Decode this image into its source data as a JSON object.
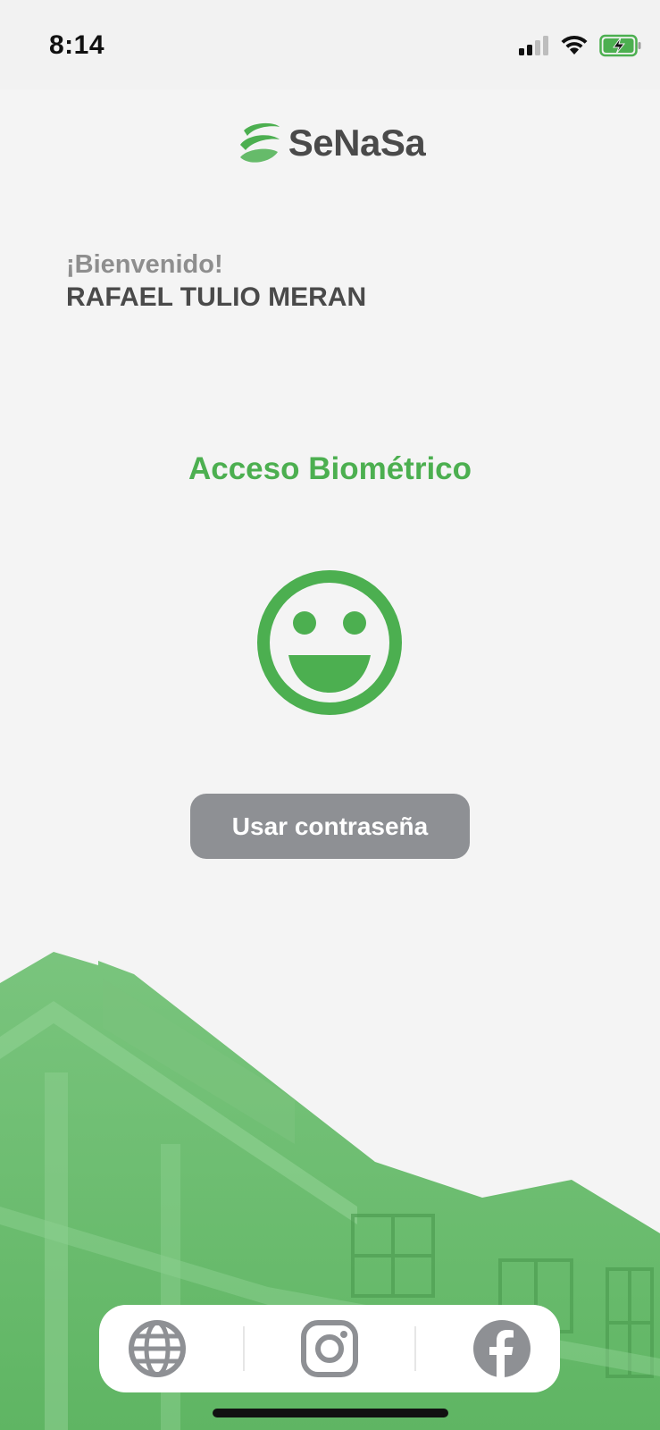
{
  "status_bar": {
    "time": "8:14",
    "icons": [
      "cellular-signal-icon",
      "wifi-icon",
      "battery-charging-icon"
    ]
  },
  "header": {
    "logo_text": "SeNaSa",
    "logo_icon": "senasa-logo-icon"
  },
  "welcome": {
    "greeting": "¡Bienvenido!",
    "user_name": "RAFAEL TULIO MERAN"
  },
  "biometric": {
    "title": "Acceso Biométrico",
    "icon": "face-id-smile-icon"
  },
  "actions": {
    "use_password_label": "Usar contraseña"
  },
  "social": {
    "items": [
      {
        "name": "website",
        "icon": "globe-icon"
      },
      {
        "name": "instagram",
        "icon": "instagram-icon"
      },
      {
        "name": "facebook",
        "icon": "facebook-icon"
      }
    ]
  },
  "colors": {
    "brand_green": "#4caf50",
    "button_gray": "#8e9094",
    "text_dark": "#4a4a4a",
    "text_muted": "#8e8e8e",
    "background": "#f4f4f4"
  }
}
